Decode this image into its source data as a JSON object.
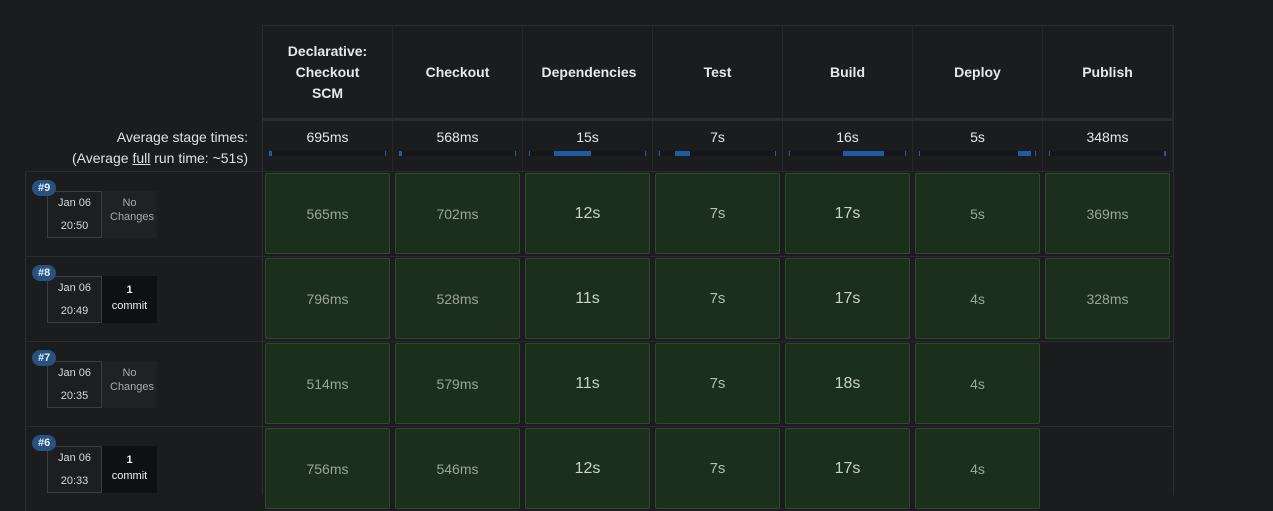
{
  "stages": [
    "Declarative: Checkout SCM",
    "Checkout",
    "Dependencies",
    "Test",
    "Build",
    "Deploy",
    "Publish"
  ],
  "averages": {
    "label_line1": "Average stage times:",
    "label_prefix": "(Average ",
    "label_full": "full",
    "label_suffix": " run time: ~51s)",
    "values": [
      "695ms",
      "568ms",
      "15s",
      "7s",
      "16s",
      "5s",
      "348ms"
    ],
    "bar_fractions": [
      0.01,
      0.01,
      0.32,
      0.13,
      0.35,
      0.11,
      0.005
    ]
  },
  "runs": [
    {
      "id": "#9",
      "date": "Jan 06",
      "time": "20:50",
      "changes": "No Changes",
      "is_commit": false,
      "stages": [
        "565ms",
        "702ms",
        "12s",
        "7s",
        "17s",
        "5s",
        "369ms"
      ]
    },
    {
      "id": "#8",
      "date": "Jan 06",
      "time": "20:49",
      "changes_count": "1",
      "changes": "commit",
      "is_commit": true,
      "stages": [
        "796ms",
        "528ms",
        "11s",
        "7s",
        "17s",
        "4s",
        "328ms"
      ]
    },
    {
      "id": "#7",
      "date": "Jan 06",
      "time": "20:35",
      "changes": "No Changes",
      "is_commit": false,
      "stages": [
        "514ms",
        "579ms",
        "11s",
        "7s",
        "18s",
        "4s",
        ""
      ]
    },
    {
      "id": "#6",
      "date": "Jan 06",
      "time": "20:33",
      "changes_count": "1",
      "changes": "commit",
      "is_commit": true,
      "stages": [
        "756ms",
        "546ms",
        "12s",
        "7s",
        "17s",
        "4s",
        ""
      ]
    }
  ],
  "colors": {
    "background": "#1b1c1e",
    "stage_success": "#1c2e1c",
    "badge": "#27517f",
    "bar": "#1f5aa3"
  }
}
